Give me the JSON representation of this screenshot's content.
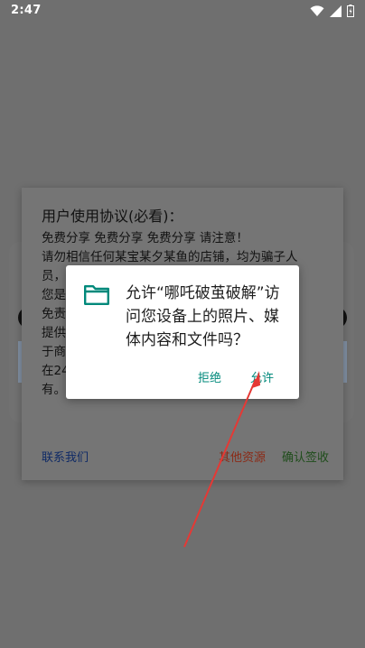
{
  "status_bar": {
    "time": "2:47"
  },
  "agreement": {
    "title": "用户使用协议(必看)：",
    "lines": [
      "免费分享 免费分享 免费分享 请注意！",
      "请勿相信任何某宝某夕某鱼的店铺，均为骗子人",
      "员，",
      "您是",
      "免责",
      "提供",
      "于商",
      "在24",
      "有。"
    ],
    "contact_label": "联系我们",
    "other_label": "其他资源",
    "accept_label": "确认签收",
    "accent_colors": {
      "contact": "#0f2a66",
      "other": "#8b2a16",
      "accept": "#1f4d1b"
    }
  },
  "permission": {
    "message": "允许“哪吒破茧破解”访问您设备上的照片、媒体内容和文件吗？",
    "deny_label": "拒绝",
    "allow_label": "允许",
    "icon": "folder-icon",
    "accent_color": "#00897b"
  },
  "annotation": {
    "color": "#e53935"
  }
}
